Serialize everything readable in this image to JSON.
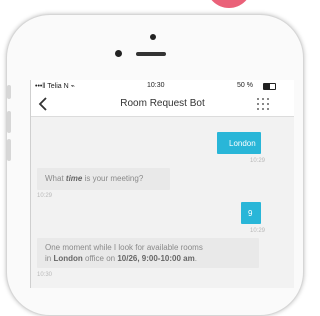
{
  "status_bar": {
    "carrier": "•••ll Telia N ⌁",
    "time": "10:30",
    "battery": "50 %"
  },
  "nav": {
    "title": "Room Request Bot"
  },
  "messages": [
    {
      "from": "user",
      "text": "London",
      "time": "10:29"
    },
    {
      "from": "bot",
      "parts": [
        "What ",
        "time",
        " is your meeting?"
      ],
      "time": "10:29"
    },
    {
      "from": "user",
      "text": "9",
      "time": "10:29"
    },
    {
      "from": "bot",
      "parts": [
        "One moment while I look for available rooms",
        "in ",
        "London",
        " office on ",
        "10/26, 9:00-10:00 am",
        "."
      ],
      "time": "10:30"
    }
  ],
  "colors": {
    "outgoing_bubble": "#29b6d8",
    "incoming_bubble": "#e9e9e9",
    "accent_blob": "#e8506a"
  }
}
